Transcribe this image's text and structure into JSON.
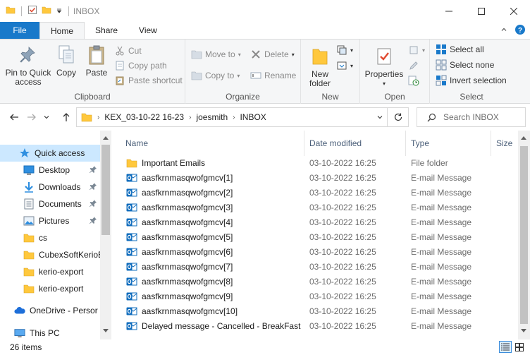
{
  "window": {
    "title": "INBOX",
    "controls": [
      "minimize",
      "maximize",
      "close"
    ]
  },
  "ribbon_tabs": [
    {
      "label": "File"
    },
    {
      "label": "Home"
    },
    {
      "label": "Share"
    },
    {
      "label": "View"
    }
  ],
  "ribbon": {
    "clipboard": {
      "label": "Clipboard",
      "pin_line1": "Pin to Quick",
      "pin_line2": "access",
      "copy": "Copy",
      "paste": "Paste",
      "cut": "Cut",
      "copy_path": "Copy path",
      "paste_shortcut": "Paste shortcut"
    },
    "organize": {
      "label": "Organize",
      "move_to": "Move to",
      "copy_to": "Copy to",
      "delete": "Delete",
      "rename": "Rename"
    },
    "new": {
      "label": "New",
      "new_folder_line1": "New",
      "new_folder_line2": "folder"
    },
    "open": {
      "label": "Open",
      "properties": "Properties"
    },
    "select": {
      "label": "Select",
      "select_all": "Select all",
      "select_none": "Select none",
      "invert_selection": "Invert selection"
    }
  },
  "address": {
    "crumbs": [
      "KEX_03-10-22 16-23",
      "joesmith",
      "INBOX"
    ]
  },
  "search": {
    "placeholder": "Search INBOX"
  },
  "navpane": {
    "items": [
      {
        "label": "Quick access",
        "icon": "star-icon",
        "selected": true
      },
      {
        "label": "Desktop",
        "icon": "desktop-icon",
        "pinned": true
      },
      {
        "label": "Downloads",
        "icon": "download-icon",
        "pinned": true
      },
      {
        "label": "Documents",
        "icon": "documents-icon",
        "pinned": true
      },
      {
        "label": "Pictures",
        "icon": "pictures-icon",
        "pinned": true
      },
      {
        "label": "cs",
        "icon": "folder-icon"
      },
      {
        "label": "CubexSoftKerioE",
        "icon": "folder-icon"
      },
      {
        "label": "kerio-export",
        "icon": "folder-icon"
      },
      {
        "label": "kerio-export",
        "icon": "folder-icon"
      },
      {
        "label": "OneDrive - Persor",
        "icon": "cloud-icon"
      },
      {
        "label": "This PC",
        "icon": "computer-icon"
      }
    ]
  },
  "filelist": {
    "columns": [
      "Name",
      "Date modified",
      "Type",
      "Size"
    ],
    "rows": [
      {
        "name": "Important Emails",
        "date": "03-10-2022 16:25",
        "type": "File folder",
        "icon": "folder-icon"
      },
      {
        "name": "aasfkrnmasqwofgmcv[1]",
        "date": "03-10-2022 16:25",
        "type": "E-mail Message",
        "icon": "outlook-message-icon"
      },
      {
        "name": "aasfkrnmasqwofgmcv[2]",
        "date": "03-10-2022 16:25",
        "type": "E-mail Message",
        "icon": "outlook-message-icon"
      },
      {
        "name": "aasfkrnmasqwofgmcv[3]",
        "date": "03-10-2022 16:25",
        "type": "E-mail Message",
        "icon": "outlook-message-icon"
      },
      {
        "name": "aasfkrnmasqwofgmcv[4]",
        "date": "03-10-2022 16:25",
        "type": "E-mail Message",
        "icon": "outlook-message-icon"
      },
      {
        "name": "aasfkrnmasqwofgmcv[5]",
        "date": "03-10-2022 16:25",
        "type": "E-mail Message",
        "icon": "outlook-message-icon"
      },
      {
        "name": "aasfkrnmasqwofgmcv[6]",
        "date": "03-10-2022 16:25",
        "type": "E-mail Message",
        "icon": "outlook-message-icon"
      },
      {
        "name": "aasfkrnmasqwofgmcv[7]",
        "date": "03-10-2022 16:25",
        "type": "E-mail Message",
        "icon": "outlook-message-icon"
      },
      {
        "name": "aasfkrnmasqwofgmcv[8]",
        "date": "03-10-2022 16:25",
        "type": "E-mail Message",
        "icon": "outlook-message-icon"
      },
      {
        "name": "aasfkrnmasqwofgmcv[9]",
        "date": "03-10-2022 16:25",
        "type": "E-mail Message",
        "icon": "outlook-message-icon"
      },
      {
        "name": "aasfkrnmasqwofgmcv[10]",
        "date": "03-10-2022 16:25",
        "type": "E-mail Message",
        "icon": "outlook-message-icon"
      },
      {
        "name": "Delayed message - Cancelled - BreakFast",
        "date": "03-10-2022 16:25",
        "type": "E-mail Message",
        "icon": "outlook-message-icon"
      }
    ]
  },
  "status": {
    "item_count": "26 items"
  },
  "colors": {
    "accent": "#1979ca",
    "selection": "#cce8ff",
    "folder": "#ffc83d",
    "outlook": "#0f6cbd"
  }
}
